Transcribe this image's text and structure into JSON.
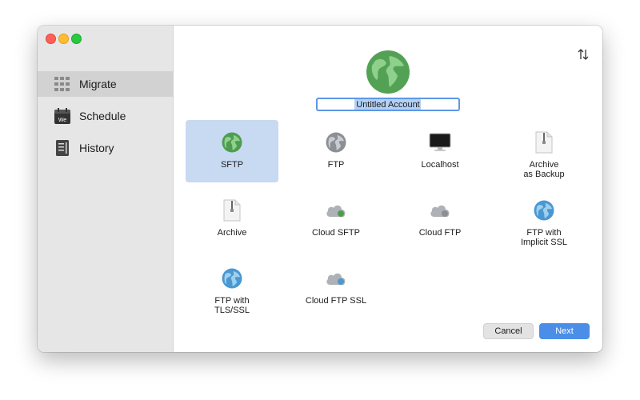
{
  "sidebar": {
    "items": [
      {
        "label": "Migrate",
        "icon": "grid-icon"
      },
      {
        "label": "Schedule",
        "icon": "calendar-icon"
      },
      {
        "label": "History",
        "icon": "document-list-icon"
      }
    ],
    "selected": "Migrate"
  },
  "calendar_badge": "We",
  "account": {
    "name": "Untitled Account",
    "icon": "globe-icon"
  },
  "toolbar": {
    "sort_icon": "sort-arrows-icon"
  },
  "types": [
    {
      "label": "SFTP",
      "icon": "globe-green-icon",
      "selected": true
    },
    {
      "label": "FTP",
      "icon": "globe-gray-icon"
    },
    {
      "label": "Localhost",
      "icon": "monitor-icon"
    },
    {
      "label": "Archive\nas Backup",
      "icon": "zip-file-icon"
    },
    {
      "label": "Archive",
      "icon": "zip-file-icon"
    },
    {
      "label": "Cloud SFTP",
      "icon": "cloud-green-icon"
    },
    {
      "label": "Cloud FTP",
      "icon": "cloud-gray-icon"
    },
    {
      "label": "FTP with\nImplicit SSL",
      "icon": "globe-blue-icon"
    },
    {
      "label": "FTP with\nTLS/SSL",
      "icon": "globe-blue-icon"
    },
    {
      "label": "Cloud FTP SSL",
      "icon": "cloud-blue-icon"
    }
  ],
  "buttons": {
    "cancel": "Cancel",
    "next": "Next"
  },
  "colors": {
    "accent": "#4a8ee8",
    "selection": "#c8d9f2",
    "sidebar": "#e6e6e6"
  }
}
